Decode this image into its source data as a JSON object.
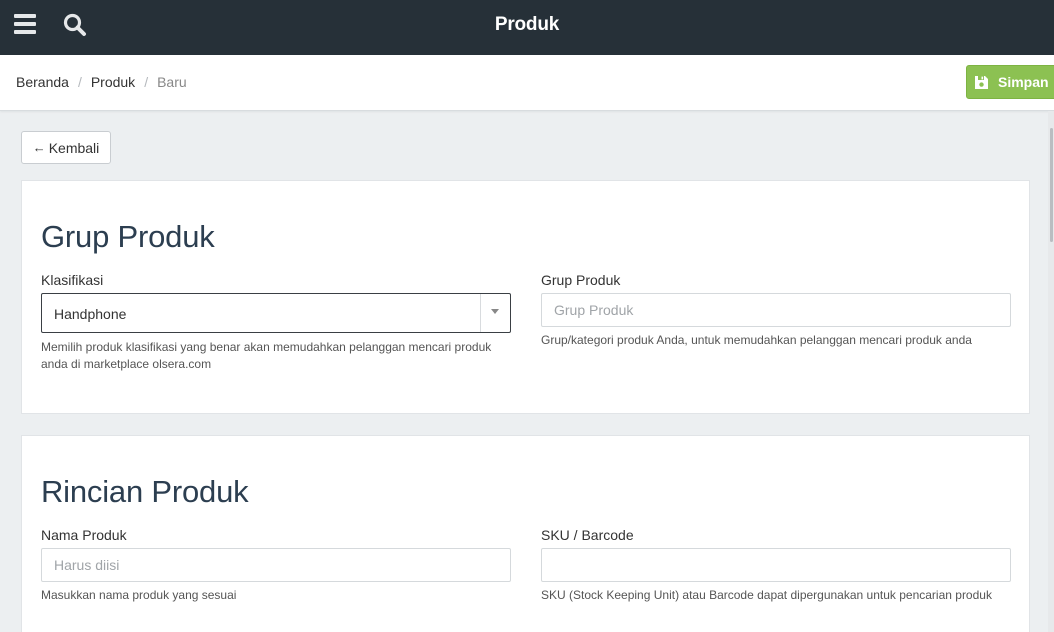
{
  "topbar": {
    "title": "Produk",
    "menu_icon": "hamburger-menu-icon",
    "search_icon": "search-icon",
    "bg_color": "#263038"
  },
  "breadcrumb": {
    "items": [
      "Beranda",
      "Produk"
    ],
    "separator": "/",
    "current": "Baru"
  },
  "toolbar": {
    "save_label": "Simpan",
    "save_icon": "floppy-disk-icon",
    "save_color": "#8cc152"
  },
  "back_button": {
    "arrow": "←",
    "label": "Kembali"
  },
  "group_section": {
    "title": "Grup Produk",
    "classification": {
      "label": "Klasifikasi",
      "selected": "Handphone",
      "help": "Memilih produk klasifikasi yang benar akan memudahkan pelanggan mencari produk anda di marketplace olsera.com"
    },
    "group": {
      "label": "Grup Produk",
      "placeholder": "Grup Produk",
      "value": "",
      "help": "Grup/kategori produk Anda, untuk memudahkan pelanggan mencari produk anda"
    }
  },
  "detail_section": {
    "title": "Rincian Produk",
    "name": {
      "label": "Nama Produk",
      "placeholder": "Harus diisi",
      "value": "",
      "help": "Masukkan nama produk yang sesuai"
    },
    "sku": {
      "label": "SKU / Barcode",
      "placeholder": "",
      "value": "",
      "help": "SKU (Stock Keeping Unit) atau Barcode dapat dipergunakan untuk pencarian produk"
    }
  }
}
